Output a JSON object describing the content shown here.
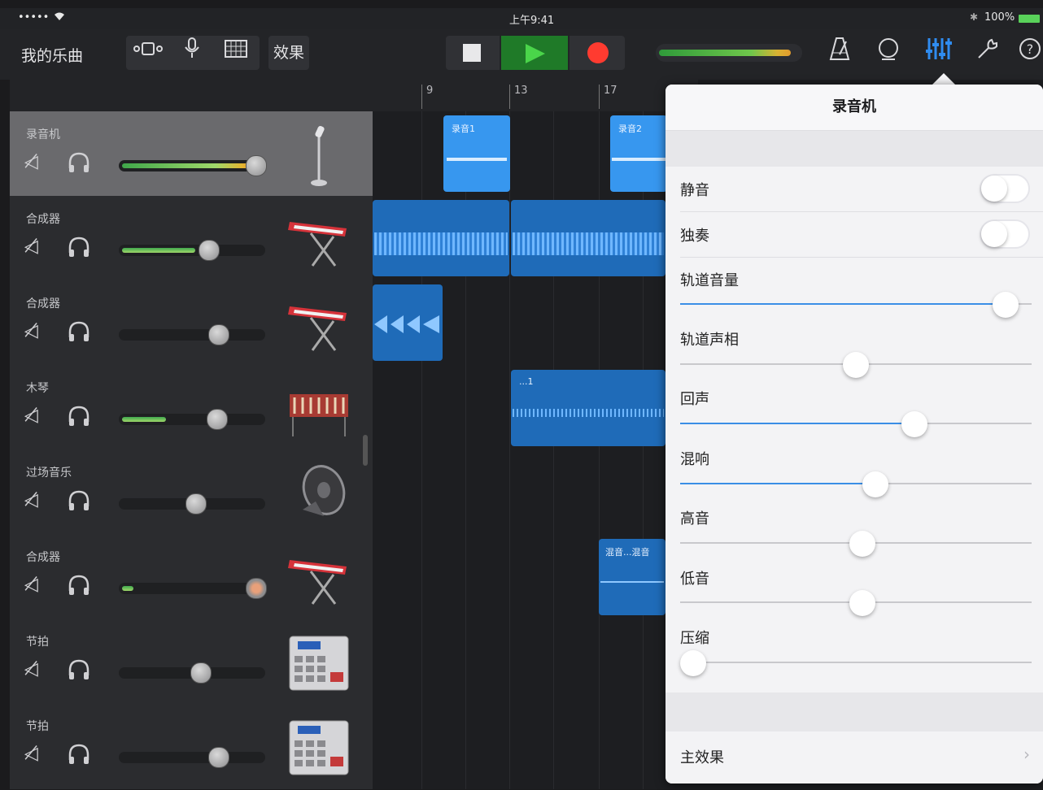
{
  "status": {
    "signal": "•••••",
    "time": "上午9:41",
    "battery": "100%"
  },
  "toolbar": {
    "my_songs": "我的乐曲",
    "effects": "效果",
    "icons": [
      "loop-browser-icon",
      "microphone-icon",
      "grid-icon",
      "stop-icon",
      "play-icon",
      "record-icon",
      "metronome-icon",
      "tuner-icon",
      "mixer-icon",
      "wrench-icon",
      "help-icon"
    ],
    "colors": {
      "play_bg": "#1f7a28",
      "play_icon": "#4ad54a",
      "record": "#ff3b30"
    }
  },
  "ruler": {
    "bars": [
      "9",
      "13",
      "17"
    ]
  },
  "tracks": [
    {
      "name": "录音机",
      "volume": 0.92,
      "selected": true,
      "instrument": "microphone-icon"
    },
    {
      "name": "合成器",
      "volume": 0.6,
      "instrument": "synth-keyboard-icon"
    },
    {
      "name": "合成器",
      "volume": 0.68,
      "instrument": "synth-keyboard-icon"
    },
    {
      "name": "木琴",
      "volume": 0.67,
      "instrument": "xylophone-icon"
    },
    {
      "name": "过场音乐",
      "volume": 0.53,
      "instrument": "speaker-icon"
    },
    {
      "name": "合成器",
      "volume": 0.93,
      "instrument": "synth-keyboard-icon"
    },
    {
      "name": "节拍",
      "volume": 0.56,
      "instrument": "drum-machine-icon"
    },
    {
      "name": "节拍",
      "volume": 0.68,
      "instrument": "drum-machine-icon"
    }
  ],
  "regions": {
    "rec1": "录音1",
    "rec2": "录音2",
    "xylo": "...1",
    "mix": "混音...混音"
  },
  "panel": {
    "title": "录音机",
    "mute_label": "静音",
    "solo_label": "独奏",
    "volume_label": "轨道音量",
    "pan_label": "轨道声相",
    "echo_label": "回声",
    "reverb_label": "混响",
    "treble_label": "高音",
    "bass_label": "低音",
    "compression_label": "压缩",
    "master_label": "主效果",
    "mute_on": false,
    "solo_on": false,
    "values": {
      "volume": 0.96,
      "pan": 0.5,
      "echo": 0.68,
      "reverb": 0.56,
      "treble": 0.52,
      "bass": 0.52,
      "compression": 0.0
    }
  }
}
